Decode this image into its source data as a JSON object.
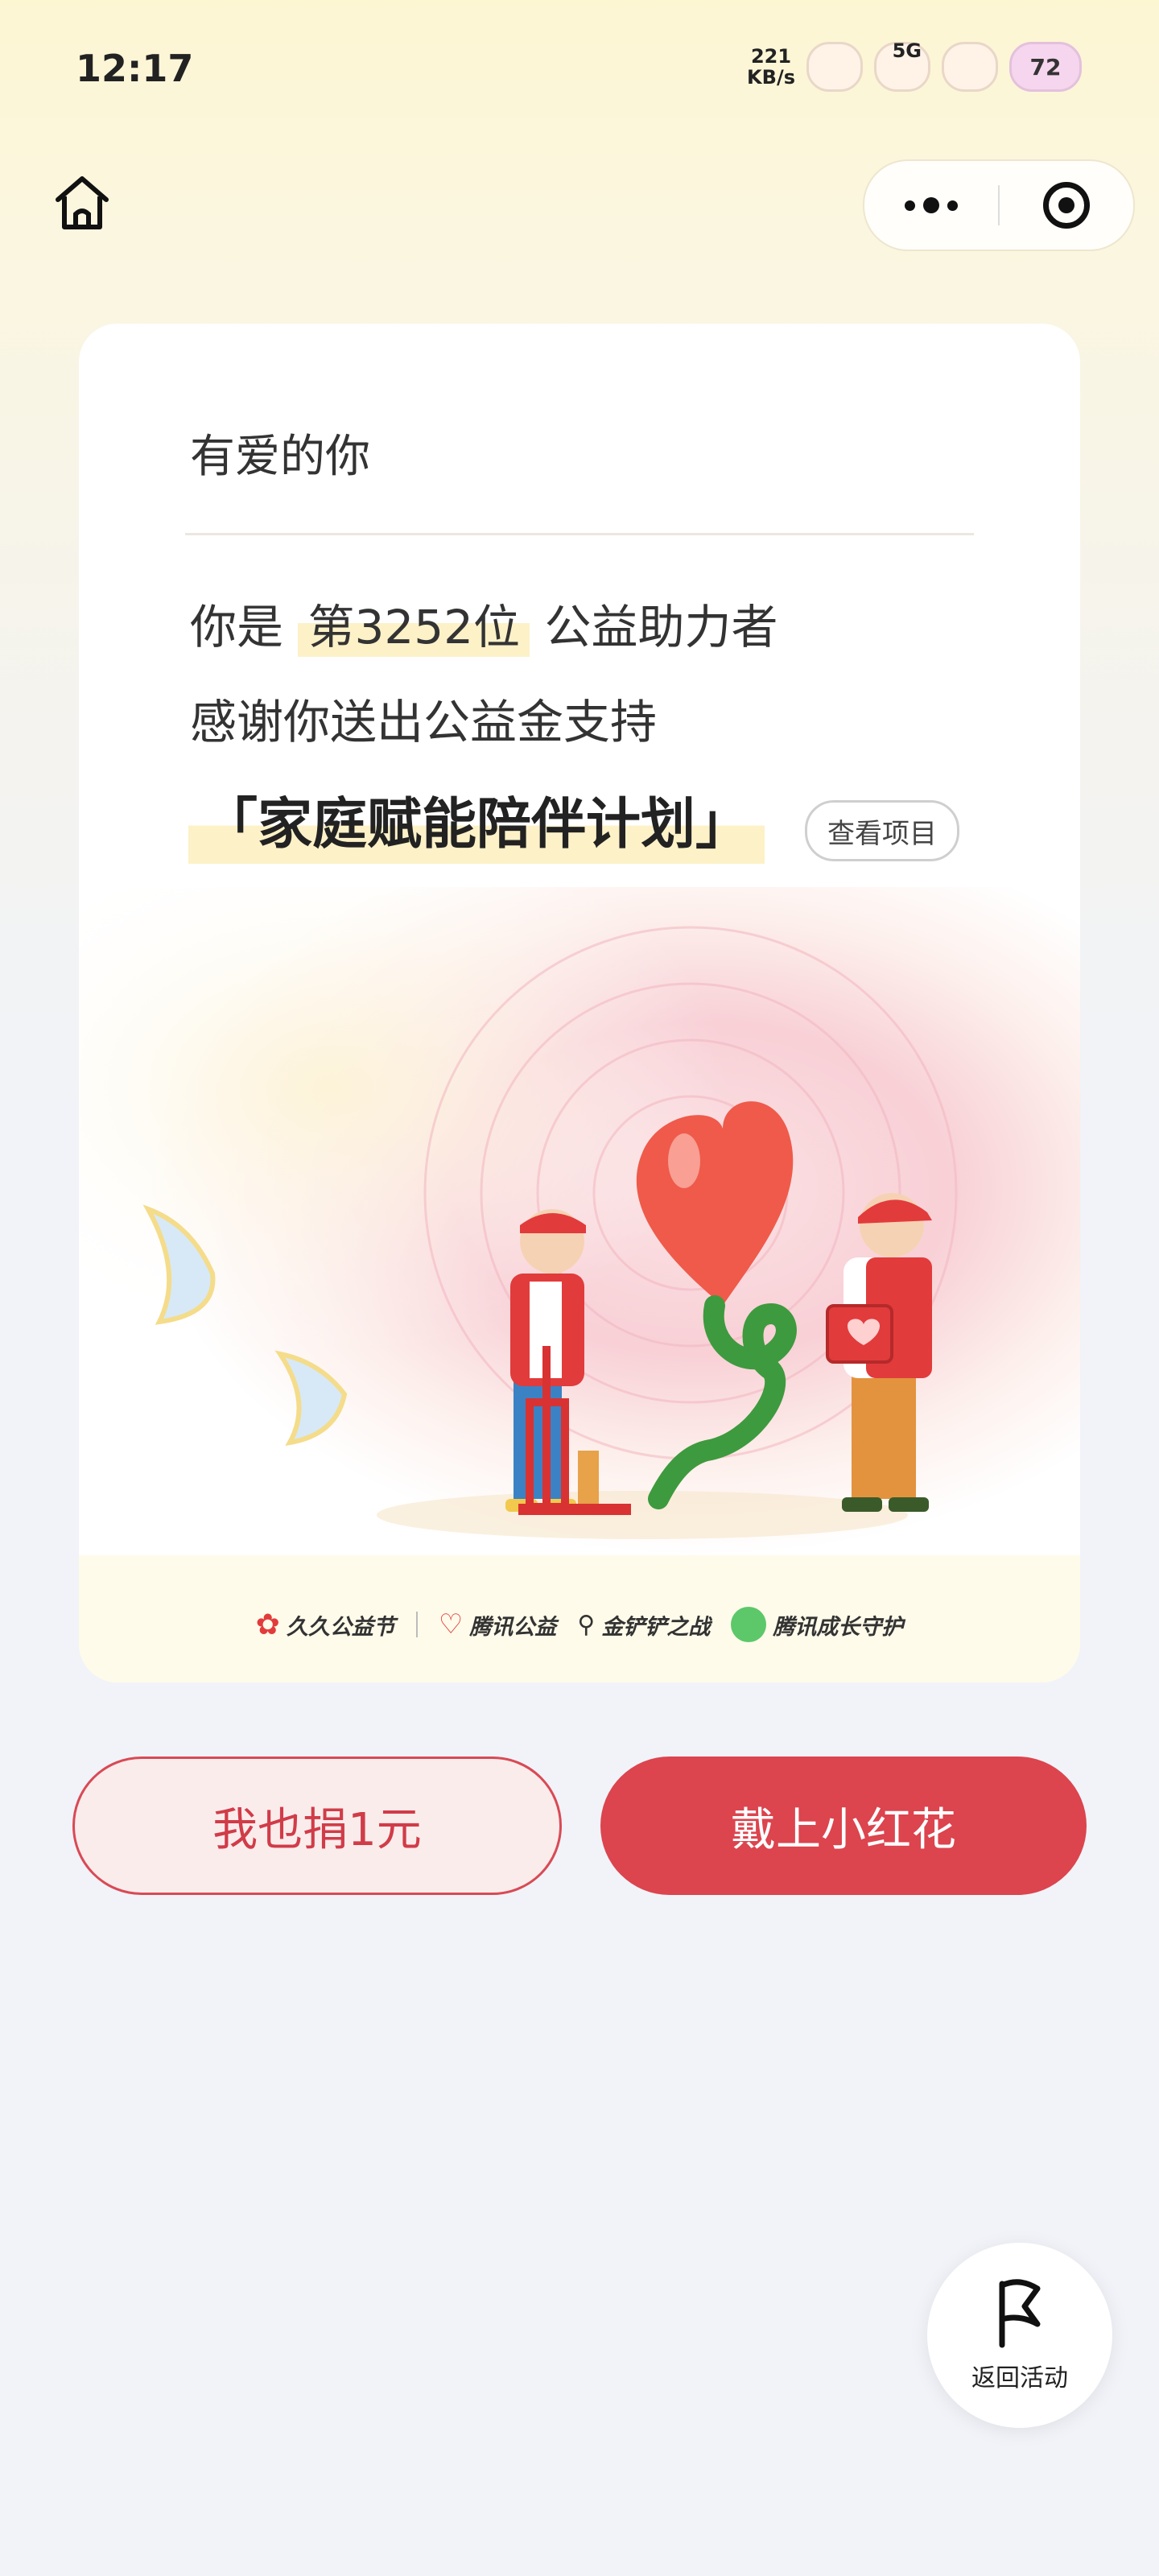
{
  "status_bar": {
    "time": "12:17",
    "net_speed_value": "221",
    "net_speed_unit": "KB/s",
    "network": "5G",
    "battery": "72"
  },
  "nav": {
    "home_icon": "home-icon",
    "more_icon": "more-icon",
    "close_icon": "target-icon"
  },
  "card": {
    "greeting": "有爱的你",
    "line1_prefix": "你是",
    "line1_rank": "第3252位",
    "line1_suffix": "公益助力者",
    "line2": "感谢你送出公益金支持",
    "project_title": "「家庭赋能陪伴计划」",
    "view_project_label": "查看项目",
    "logos": [
      "久久公益节",
      "腾讯公益",
      "金铲铲之战",
      "腾讯成长守护"
    ]
  },
  "actions": {
    "donate_label": "我也捐1元",
    "flower_label": "戴上小红花"
  },
  "float": {
    "back_label": "返回活动"
  },
  "colors": {
    "primary_red": "#dc444e",
    "highlight_yellow": "#fdf1c8"
  }
}
